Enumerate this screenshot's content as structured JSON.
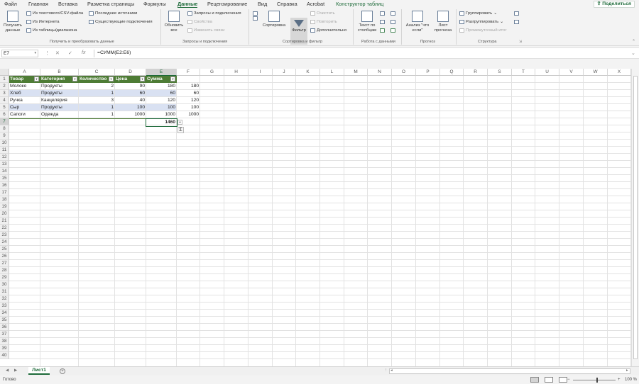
{
  "menu": {
    "tabs": [
      "Файл",
      "Главная",
      "Вставка",
      "Разметка страницы",
      "Формулы",
      "Данные",
      "Рецензирование",
      "Вид",
      "Справка",
      "Acrobat",
      "Конструктор таблиц"
    ],
    "active_tab": "Данные",
    "share_label": "Поделиться"
  },
  "ribbon": {
    "get_data": {
      "get_data_label": "Получить данные",
      "from_text_csv": "Из текстового/CSV-файла",
      "from_web": "Из Интернета",
      "from_table": "Из таблицы/диапазона",
      "recent_sources": "Последние источники",
      "existing_connections": "Существующие подключения",
      "group_label": "Получить и преобразовать данные"
    },
    "queries": {
      "refresh_all": "Обновить все",
      "queries_connections": "Запросы и подключения",
      "properties": "Свойства",
      "edit_links": "Изменить связи",
      "group_label": "Запросы и подключения"
    },
    "sort_filter": {
      "sort": "Сортировка",
      "filter": "Фильтр",
      "clear": "Очистить",
      "reapply": "Повторить",
      "advanced": "Дополнительно",
      "group_label": "Сортировка и фильтр"
    },
    "data_tools": {
      "text_to_columns": "Текст по столбцам",
      "group_label": "Работа с данными"
    },
    "forecast": {
      "what_if": "Анализ \"что если\"",
      "forecast_sheet": "Лист прогноза",
      "group_label": "Прогноз"
    },
    "outline": {
      "group": "Группировать",
      "ungroup": "Разгруппировать",
      "subtotal": "Промежуточный итог",
      "group_label": "Структура"
    }
  },
  "formula_bar": {
    "name_box": "E7",
    "formula": "=СУММ(E2:E6)"
  },
  "grid": {
    "columns": [
      "A",
      "B",
      "C",
      "D",
      "E",
      "F",
      "G",
      "H",
      "I",
      "J",
      "K",
      "L",
      "M",
      "N",
      "O",
      "P",
      "Q",
      "R",
      "S",
      "T",
      "U",
      "V",
      "W",
      "X"
    ],
    "selected_column": "E",
    "selected_row": 7,
    "row_count": 40,
    "table_headers": [
      "Товар",
      "Категория",
      "Количество",
      "Цена",
      "Сумма"
    ],
    "table_rows": [
      [
        "Молоко",
        "Продукты",
        "2",
        "90",
        "180"
      ],
      [
        "Хлеб",
        "Продукты",
        "1",
        "60",
        "60"
      ],
      [
        "Ручка",
        "Канцелярия",
        "3",
        "40",
        "120"
      ],
      [
        "Сыр",
        "Продукты",
        "1",
        "100",
        "100"
      ],
      [
        "Сапоги",
        "Одежда",
        "1",
        "1000",
        "1000"
      ]
    ],
    "column_f_values": [
      "180",
      "60",
      "120",
      "100",
      "1000"
    ],
    "total_value": "1460"
  },
  "sheets": {
    "active": "Лист1"
  },
  "status": {
    "ready": "Готово",
    "zoom": "100 %"
  },
  "colors": {
    "accent": "#1d6a39",
    "table_header": "#4e7c35",
    "table_band": "#d9e1f2"
  }
}
